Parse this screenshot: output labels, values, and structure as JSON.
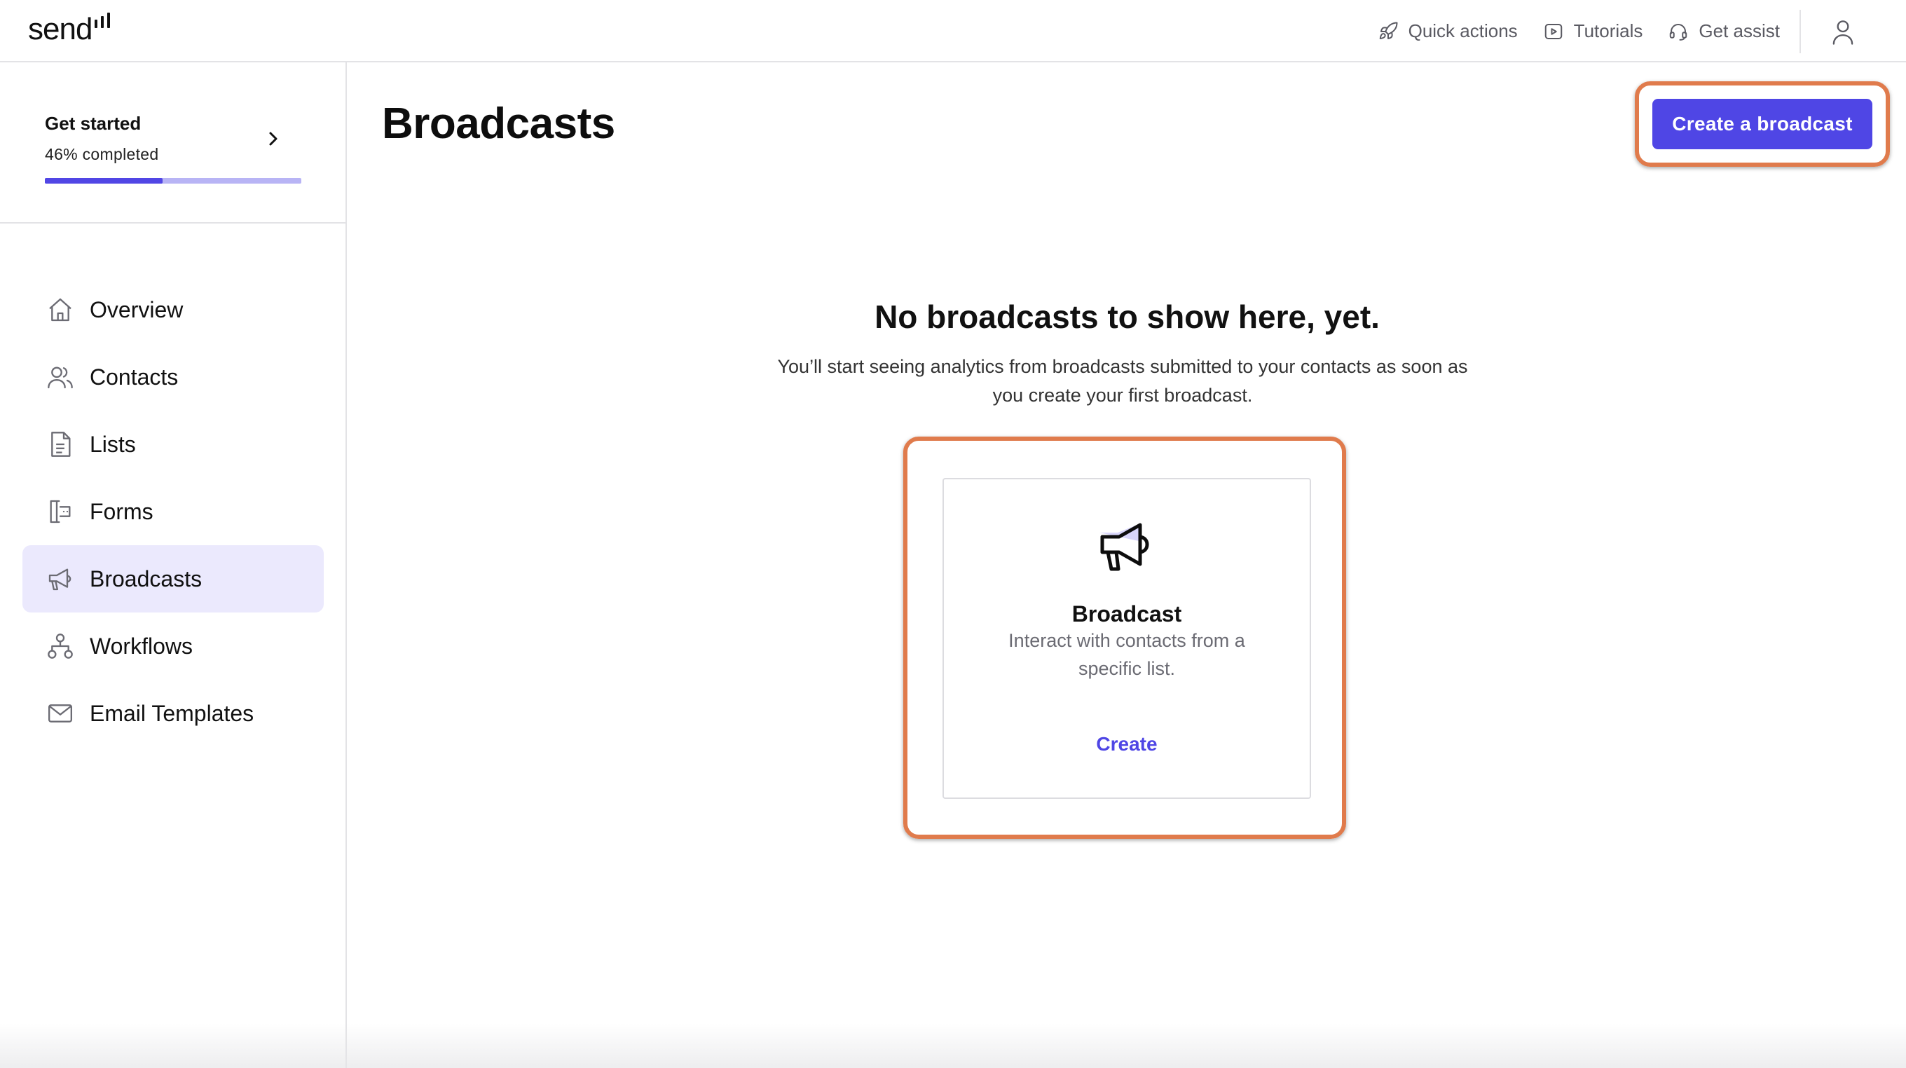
{
  "brand": {
    "logo_text": "send"
  },
  "topbar": {
    "quick_actions": {
      "label": "Quick actions",
      "icon": "rocket-icon"
    },
    "tutorials": {
      "label": "Tutorials",
      "icon": "play-icon"
    },
    "get_assist": {
      "label": "Get assist",
      "icon": "headset-icon"
    },
    "user": {
      "icon": "user-icon"
    }
  },
  "get_started": {
    "title": "Get started",
    "progress_text": "46% completed",
    "progress": 0.46
  },
  "sidebar": {
    "items": [
      {
        "label": "Overview",
        "icon": "home-icon",
        "active": false
      },
      {
        "label": "Contacts",
        "icon": "users-icon",
        "active": false
      },
      {
        "label": "Lists",
        "icon": "document-icon",
        "active": false
      },
      {
        "label": "Forms",
        "icon": "form-icon",
        "active": false
      },
      {
        "label": "Broadcasts",
        "icon": "megaphone-icon",
        "active": true
      },
      {
        "label": "Workflows",
        "icon": "workflow-icon",
        "active": false
      },
      {
        "label": "Email Templates",
        "icon": "mail-icon",
        "active": false
      }
    ]
  },
  "main": {
    "title": "Broadcasts",
    "create_button": "Create a broadcast",
    "empty_title": "No broadcasts to show here, yet.",
    "empty_description": "You’ll start seeing analytics from broadcasts submitted to your contacts as soon as you create your first broadcast.",
    "card": {
      "icon": "megaphone-icon",
      "title": "Broadcast",
      "description": "Interact with contacts from a specific list.",
      "link": "Create"
    }
  },
  "colors": {
    "accent": "#4f46e5",
    "highlight": "#e07b4c",
    "active_bg": "#ebe9fd"
  }
}
